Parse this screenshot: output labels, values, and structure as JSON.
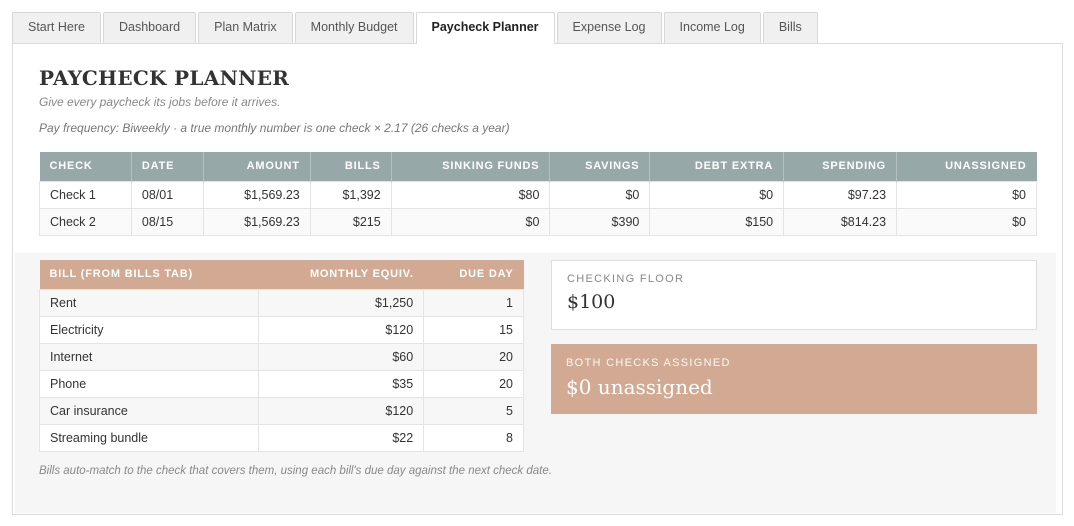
{
  "tabs": [
    {
      "label": "Start Here"
    },
    {
      "label": "Dashboard"
    },
    {
      "label": "Plan Matrix"
    },
    {
      "label": "Monthly Budget"
    },
    {
      "label": "Paycheck Planner"
    },
    {
      "label": "Expense Log"
    },
    {
      "label": "Income Log"
    },
    {
      "label": "Bills"
    }
  ],
  "page": {
    "title": "PAYCHECK PLANNER",
    "subtitle": "Give every paycheck its jobs before it arrives.",
    "frequency_note": "Pay frequency: Biweekly · a true monthly number is one check × 2.17 (26 checks a year)"
  },
  "checks_table": {
    "headers": [
      "CHECK",
      "DATE",
      "AMOUNT",
      "BILLS",
      "SINKING FUNDS",
      "SAVINGS",
      "DEBT EXTRA",
      "SPENDING",
      "UNASSIGNED"
    ],
    "rows": [
      [
        "Check 1",
        "08/01",
        "$1,569.23",
        "$1,392",
        "$80",
        "$0",
        "$0",
        "$97.23",
        "$0"
      ],
      [
        "Check 2",
        "08/15",
        "$1,569.23",
        "$215",
        "$0",
        "$390",
        "$150",
        "$814.23",
        "$0"
      ]
    ]
  },
  "bills_table": {
    "headers": [
      "BILL (FROM BILLS TAB)",
      "MONTHLY EQUIV.",
      "DUE DAY"
    ],
    "rows": [
      [
        "Rent",
        "$1,250",
        "1"
      ],
      [
        "Electricity",
        "$120",
        "15"
      ],
      [
        "Internet",
        "$60",
        "20"
      ],
      [
        "Phone",
        "$35",
        "20"
      ],
      [
        "Car insurance",
        "$120",
        "5"
      ],
      [
        "Streaming bundle",
        "$22",
        "8"
      ]
    ]
  },
  "checking_floor": {
    "label": "CHECKING FLOOR",
    "value": "$100"
  },
  "assignment_status": {
    "label": "BOTH CHECKS ASSIGNED",
    "value": "$0 unassigned"
  },
  "footnote": "Bills auto-match to the check that covers them, using each bill's due day against the next check date.",
  "colors": {
    "checks_header": "#97a8a9",
    "bills_header": "#d2aa93",
    "status_card": "#d2aa93"
  }
}
